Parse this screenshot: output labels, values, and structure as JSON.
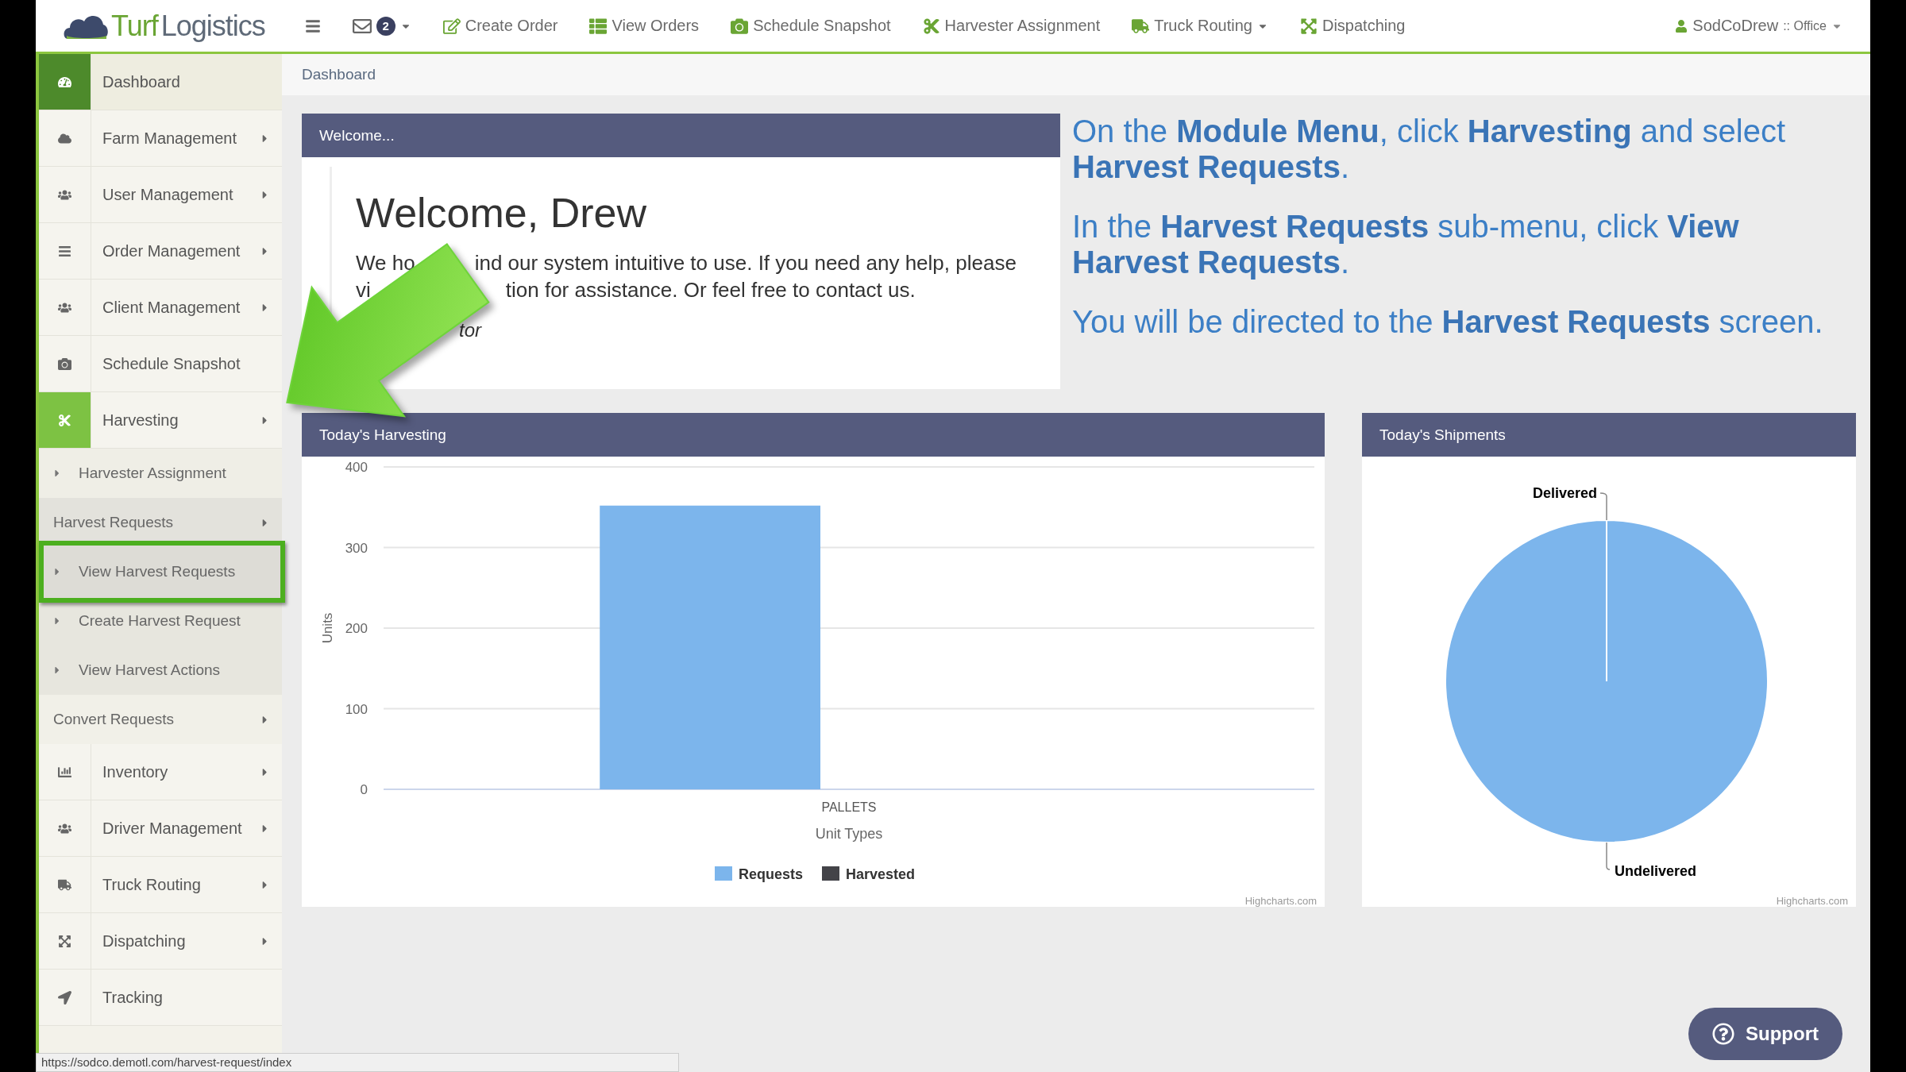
{
  "topbar": {
    "brand": {
      "first": "Turf",
      "second": "Logistics"
    },
    "mail": {
      "count": "2"
    },
    "nav": [
      {
        "label": "Create Order",
        "dropdown": false
      },
      {
        "label": "View Orders",
        "dropdown": false
      },
      {
        "label": "Schedule Snapshot",
        "dropdown": false
      },
      {
        "label": "Harvester Assignment",
        "dropdown": false
      },
      {
        "label": "Truck Routing",
        "dropdown": true
      },
      {
        "label": "Dispatching",
        "dropdown": false
      }
    ],
    "user": {
      "name": "SodCoDrew",
      "role": ":: Office"
    }
  },
  "sidebar": {
    "items": [
      {
        "label": "Dashboard",
        "selected": true,
        "expanded": false,
        "submenu": false
      },
      {
        "label": "Farm Management",
        "selected": false,
        "expanded": false,
        "submenu": true
      },
      {
        "label": "User Management",
        "selected": false,
        "expanded": false,
        "submenu": true
      },
      {
        "label": "Order Management",
        "selected": false,
        "expanded": false,
        "submenu": true
      },
      {
        "label": "Client Management",
        "selected": false,
        "expanded": false,
        "submenu": true
      },
      {
        "label": "Schedule Snapshot",
        "selected": false,
        "expanded": false,
        "submenu": false
      },
      {
        "label": "Harvesting",
        "selected": false,
        "expanded": true,
        "submenu": true,
        "children": [
          {
            "kind": "link",
            "label": "Harvester Assignment",
            "highlighted": false
          },
          {
            "kind": "group",
            "label": "Harvest Requests",
            "expanded": true,
            "children": [
              {
                "kind": "link",
                "label": "View Harvest Requests",
                "highlighted": true
              },
              {
                "kind": "link",
                "label": "Create Harvest Request",
                "highlighted": false
              },
              {
                "kind": "link",
                "label": "View Harvest Actions",
                "highlighted": false
              }
            ]
          },
          {
            "kind": "group",
            "label": "Convert Requests",
            "expanded": false
          }
        ]
      },
      {
        "label": "Inventory",
        "selected": false,
        "expanded": false,
        "submenu": true
      },
      {
        "label": "Driver Management",
        "selected": false,
        "expanded": false,
        "submenu": true
      },
      {
        "label": "Truck Routing",
        "selected": false,
        "expanded": false,
        "submenu": true
      },
      {
        "label": "Dispatching",
        "selected": false,
        "expanded": false,
        "submenu": true
      },
      {
        "label": "Tracking",
        "selected": false,
        "expanded": false,
        "submenu": false
      }
    ]
  },
  "breadcrumb": "Dashboard",
  "welcome": {
    "header": "Welcome...",
    "heading": "Welcome, Drew",
    "lines": [
      {
        "before": "We ho",
        "after": "ind our system intuitive to use. If you need any help, please"
      },
      {
        "before": "vi",
        "after": "tion for assistance. Or feel free to contact us."
      }
    ],
    "signature": "tor"
  },
  "instructions": [
    "On the **Module Menu**, click **Harvesting** and select **Harvest Requests**.",
    "In the **Harvest Requests** sub-menu, click **View Harvest Requests**.",
    "You will be directed to the **Harvest Requests** screen."
  ],
  "harvesting": {
    "header": "Today's Harvesting",
    "credit": "Highcharts.com",
    "chart_data": {
      "type": "bar",
      "xlabel": "Unit Types",
      "ylabel": "Units",
      "categories": [
        "PALLETS"
      ],
      "series": [
        {
          "name": "Requests",
          "color": "#7cb5ec",
          "values": [
            352
          ]
        },
        {
          "name": "Harvested",
          "color": "#434348",
          "values": [
            0
          ]
        }
      ],
      "ylim": [
        0,
        400
      ],
      "yticks": [
        0,
        100,
        200,
        300,
        400
      ],
      "grid": true
    }
  },
  "shipments": {
    "header": "Today's Shipments",
    "credit": "Highcharts.com",
    "chart_data": {
      "type": "pie",
      "categories": [
        "Delivered",
        "Undelivered"
      ],
      "series": [
        {
          "color": "#7cb5ec",
          "values": [
            0,
            1
          ]
        }
      ]
    }
  },
  "status_url": "https://sodco.demotl.com/harvest-request/index",
  "support": "Support"
}
